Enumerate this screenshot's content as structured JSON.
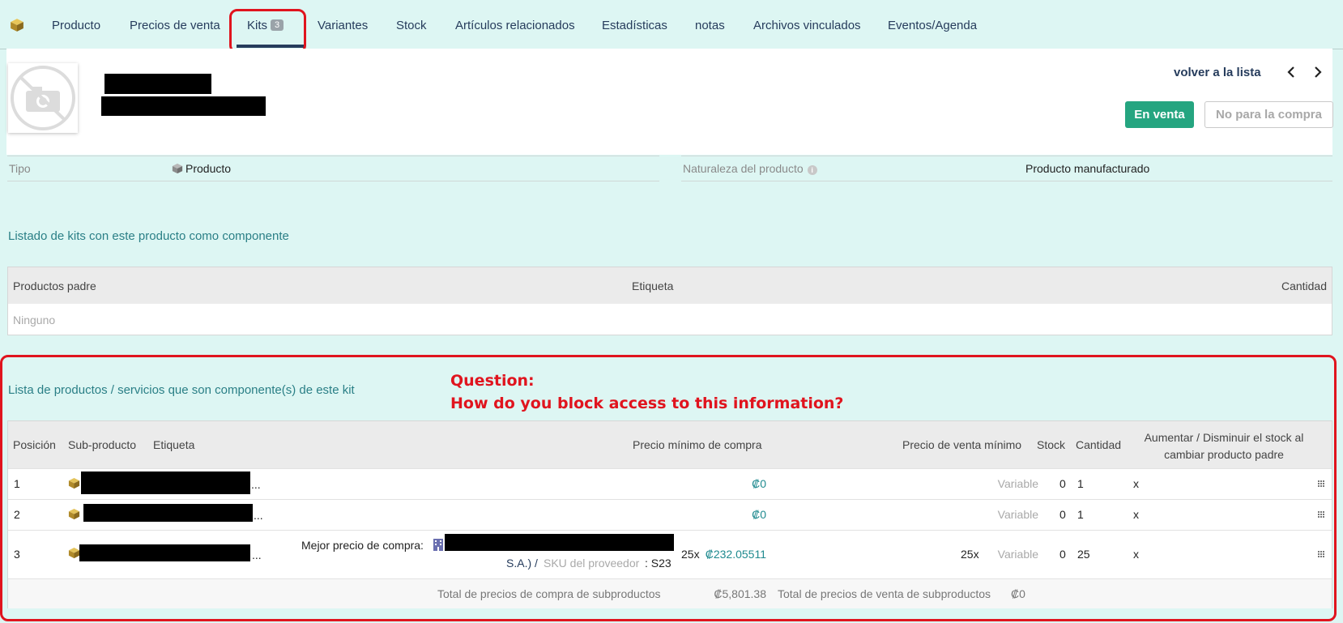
{
  "tabs": [
    {
      "label": "Producto"
    },
    {
      "label": "Precios de venta"
    },
    {
      "label": "Kits",
      "badge": "3"
    },
    {
      "label": "Variantes"
    },
    {
      "label": "Stock"
    },
    {
      "label": "Artículos relacionados"
    },
    {
      "label": "Estadísticas"
    },
    {
      "label": "notas"
    },
    {
      "label": "Archivos vinculados"
    },
    {
      "label": "Eventos/Agenda"
    }
  ],
  "header": {
    "back_link": "volver a la lista",
    "status_sale": "En venta",
    "status_purchase": "No para la compra"
  },
  "fields": {
    "type_label": "Tipo",
    "type_value": "Producto",
    "nature_label": "Naturaleza del producto",
    "nature_value": "Producto manufacturado"
  },
  "parents": {
    "title": "Listado de kits con este producto como componente",
    "columns": [
      "Productos padre",
      "Etiqueta",
      "Cantidad"
    ],
    "empty": "Ninguno"
  },
  "components": {
    "title": "Lista de productos / servicios que son componente(s) de este kit",
    "question_line1": "Question:",
    "question_line2": "How do you block access to this information?",
    "columns": {
      "position": "Posición",
      "subproduct": "Sub-producto",
      "label": "Etiqueta",
      "min_purchase": "Precio mínimo de compra",
      "min_sale": "Precio de venta mínimo",
      "stock": "Stock",
      "qty": "Cantidad",
      "adjust_line1": "Aumentar / Disminuir el stock al",
      "adjust_line2": "cambiar producto padre"
    },
    "rows": [
      {
        "pos": "1",
        "ellipsis": "...",
        "purchase": "₡0",
        "sale": "Variable",
        "stock": "0",
        "qty": "1",
        "adjust": "x"
      },
      {
        "pos": "2",
        "ellipsis": "...",
        "purchase": "₡0",
        "sale": "Variable",
        "stock": "0",
        "qty": "1",
        "adjust": "x"
      },
      {
        "pos": "3",
        "ellipsis": "...",
        "best_price_label": "Mejor precio de compra:",
        "supplier_suffix": "S.A.) /",
        "sku_label": "SKU del proveedor",
        "sku_value": ": S23",
        "purchase_prefix": "25x",
        "purchase": "₡232.05511",
        "sale_prefix": "25x",
        "sale": "Variable",
        "stock": "0",
        "qty": "25",
        "adjust": "x"
      }
    ],
    "totals": {
      "purchase_label": "Total de precios de compra de subproductos",
      "purchase_value": "₡5,801.38",
      "sale_label": "Total de precios de venta de subproductos",
      "sale_value": "₡0"
    }
  }
}
